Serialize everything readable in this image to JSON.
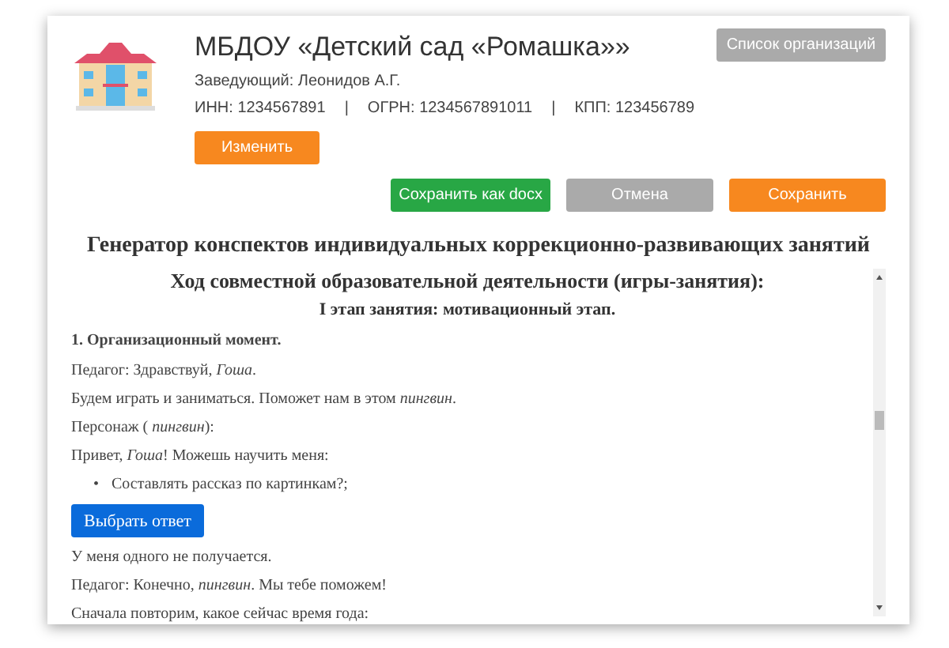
{
  "organization": {
    "name": "МБДОУ «Детский сад «Ромашка»»",
    "head": "Заведующий: Леонидов А.Г.",
    "inn": "ИНН: 1234567891",
    "ogrn": "ОГРН: 1234567891011",
    "kpp": "КПП: 123456789",
    "separators": [
      "|",
      "|"
    ],
    "list_button": "Список организаций",
    "edit_button": "Изменить"
  },
  "actions": [
    {
      "label": "Сохранить как docx",
      "kind": "success"
    },
    {
      "label": "Отмена",
      "kind": "neutral"
    },
    {
      "label": "Сохранить",
      "kind": "primary"
    }
  ],
  "title": "Генератор конспектов индивидуальных коррекционно-развивающих занятий",
  "content": [
    {
      "kind": "heading",
      "text": "Ход совместной образовательной деятельности (игры-занятия):"
    },
    {
      "kind": "subheading",
      "text": "I этап занятия: мотивационный этап."
    },
    {
      "kind": "section",
      "text": "1. Организационный момент."
    },
    {
      "kind": "paragraph",
      "text": "Педагог: Здравствуй, *Гоша*."
    },
    {
      "kind": "paragraph",
      "text": "Будем играть и заниматься. Поможет нам в этом *пингвин*."
    },
    {
      "kind": "paragraph",
      "text": "Персонаж ( *пингвин*):"
    },
    {
      "kind": "paragraph",
      "text": "Привет, *Гоша*! Можешь научить меня:"
    },
    {
      "kind": "bullet",
      "marker": "•",
      "text": "Составлять рассказ по картинкам?;"
    },
    {
      "kind": "button",
      "text": "Выбрать ответ"
    },
    {
      "kind": "paragraph",
      "text": "У меня одного не получается."
    },
    {
      "kind": "paragraph",
      "text": "Педагог: Конечно, *пингвин*. Мы тебе поможем!"
    },
    {
      "kind": "paragraph",
      "text": "Сначала повторим, какое сейчас время года:"
    }
  ]
}
